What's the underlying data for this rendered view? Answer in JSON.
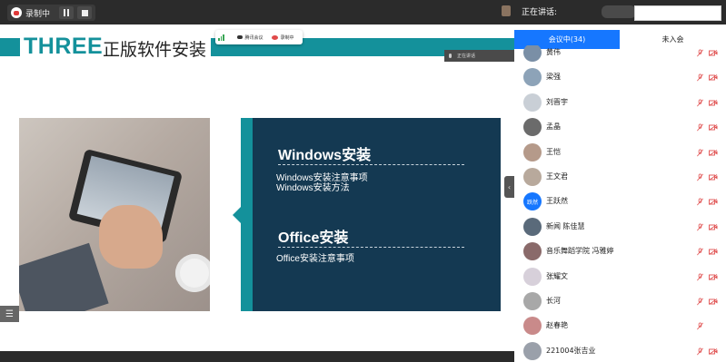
{
  "recording": {
    "label": "录制中"
  },
  "slide": {
    "section_label": "THREE",
    "title": "正版软件安装",
    "accent_color": "#14919b",
    "panel_color": "#143952",
    "meeting_pill": {
      "item1": "腾讯会议",
      "item2": "录制中"
    },
    "speaking_tag": "正在讲话",
    "sections": [
      {
        "heading": "Windows安装",
        "items": [
          "Windows安装注意事项",
          "Windows安装方法"
        ]
      },
      {
        "heading": "Office安装",
        "items": [
          "Office安装注意事项"
        ]
      }
    ]
  },
  "sidebar": {
    "speaking_label": "正在讲话:",
    "tabs": {
      "in_meeting": "会议中(34)",
      "not_joined": "未入会"
    },
    "accent_color": "#1677ff",
    "muted_color": "#e05050",
    "participants": [
      {
        "name": "黄伟",
        "avatar_text": "",
        "avatar_color": "#7a8fa6"
      },
      {
        "name": "梁强",
        "avatar_text": "",
        "avatar_color": "#8da3b8"
      },
      {
        "name": "刘晋宇",
        "avatar_text": "",
        "avatar_color": "#c9cfd6"
      },
      {
        "name": "孟晶",
        "avatar_text": "",
        "avatar_color": "#6b6b6b"
      },
      {
        "name": "王恺",
        "avatar_text": "",
        "avatar_color": "#b59a8a"
      },
      {
        "name": "王文君",
        "avatar_text": "",
        "avatar_color": "#b8a99c"
      },
      {
        "name": "王跃然",
        "avatar_text": "跃然",
        "avatar_color": "#1677ff"
      },
      {
        "name": "新闻 陈佳慧",
        "avatar_text": "",
        "avatar_color": "#5a6a7a"
      },
      {
        "name": "音乐舞蹈学院 冯雅婷",
        "avatar_text": "",
        "avatar_color": "#8a6a6a"
      },
      {
        "name": "张耀文",
        "avatar_text": "",
        "avatar_color": "#d7d0da"
      },
      {
        "name": "长河",
        "avatar_text": "",
        "avatar_color": "#a8a8a8"
      },
      {
        "name": "赵春艳",
        "avatar_text": "",
        "avatar_color": "#c98a8a"
      },
      {
        "name": "221004张吉业",
        "avatar_text": "",
        "avatar_color": "#9aa0aa"
      }
    ]
  }
}
